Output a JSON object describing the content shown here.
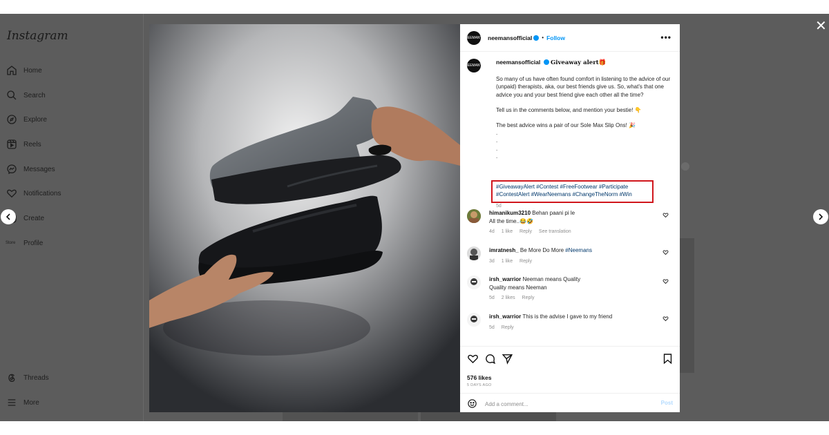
{
  "sidebar": {
    "logo": "Instagram",
    "items": [
      {
        "label": "Home",
        "icon": "home-icon"
      },
      {
        "label": "Search",
        "icon": "search-icon"
      },
      {
        "label": "Explore",
        "icon": "compass-icon"
      },
      {
        "label": "Reels",
        "icon": "reels-icon"
      },
      {
        "label": "Messages",
        "icon": "messenger-icon"
      },
      {
        "label": "Notifications",
        "icon": "heart-icon"
      },
      {
        "label": "Create",
        "icon": "plus-icon"
      },
      {
        "label": "Profile",
        "icon": "profile-avatar",
        "avatar_text": "Store"
      }
    ],
    "bottom": [
      {
        "label": "Threads",
        "icon": "threads-icon"
      },
      {
        "label": "More",
        "icon": "menu-icon"
      }
    ]
  },
  "post": {
    "username": "neemansofficial",
    "follow_label": "Follow",
    "dot": "•",
    "avatar_text": "NEEMAN'S",
    "caption": {
      "username": "neemansofficial",
      "title": "Giveaway alert🎁",
      "para1": "So many of us have often found comfort in listening to the advice of our (unpaid) therapists, aka, our best friends give us. So, what's that one advice you and your best friend give each other all the time?",
      "para2": "Tell us in the comments below, and mention your bestie! 👇",
      "para3": "The best advice wins a pair of our Sole Max Slip Ons! 🎉",
      "dots": ".\n.\n.\n.",
      "hashtags_line1": "#GiveawayAlert #Contest #FreeFootwear #Participate",
      "hashtags_line2": "#ContestAlert #WearNeemans #ChangeTheNorm #Win",
      "time": "5d"
    },
    "comments": [
      {
        "user": "himanikum3210",
        "text": "Behan paani pi le",
        "text2": "All the time..😂🤣",
        "time": "4d",
        "likes": "1 like",
        "reply": "Reply",
        "translate": "See translation"
      },
      {
        "user": "imratnesh_",
        "text": "Be More Do More",
        "hashtag": "#Neemans",
        "time": "3d",
        "likes": "1 like",
        "reply": "Reply"
      },
      {
        "user": "irsh_warrior",
        "text": "Neeman means Quality",
        "text2": "Quality means Neeman",
        "time": "5d",
        "likes": "2 likes",
        "reply": "Reply"
      },
      {
        "user": "irsh_warrior",
        "text": "This is the advise I gave to my friend",
        "time": "5d",
        "reply": "Reply"
      }
    ],
    "likes": "576 likes",
    "posted_ago": "5 DAYS AGO",
    "comment_placeholder": "Add a comment...",
    "post_label": "Post"
  },
  "modal": {
    "close": "✕"
  },
  "colors": {
    "accent": "#0095f6",
    "hashtag": "#00376b",
    "highlight_box": "#d0161c",
    "overlay": "#5c5c5c"
  }
}
